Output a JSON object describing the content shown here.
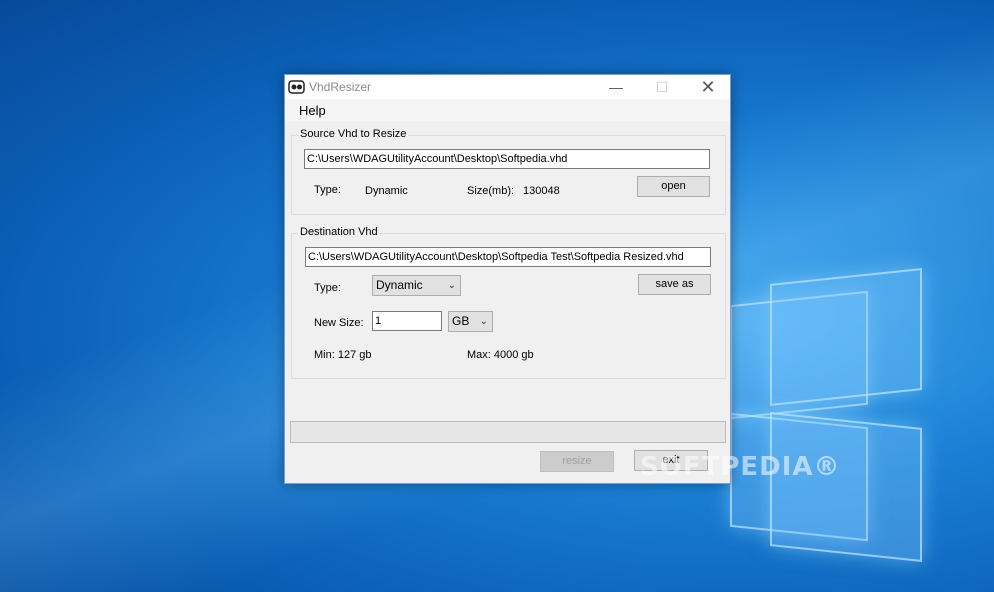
{
  "window": {
    "title": "VhdResizer",
    "minimize_glyph": "—",
    "maximize_glyph": "☐",
    "close_glyph": "✕"
  },
  "menu": {
    "help": "Help"
  },
  "source": {
    "group_label": "Source Vhd to Resize",
    "path": "C:\\Users\\WDAGUtilityAccount\\Desktop\\Softpedia.vhd",
    "type_label": "Type:",
    "type_value": "Dynamic",
    "size_label": "Size(mb):",
    "size_value": "130048",
    "open_label": "open"
  },
  "destination": {
    "group_label": "Destination Vhd",
    "path": "C:\\Users\\WDAGUtilityAccount\\Desktop\\Softpedia Test\\Softpedia Resized.vhd",
    "type_label": "Type:",
    "type_selected": "Dynamic",
    "save_as_label": "save as",
    "new_size_label": "New Size:",
    "new_size_value": "1",
    "unit_selected": "GB",
    "min_text": "Min: 127 gb",
    "max_text": "Max: 4000 gb"
  },
  "progress": {
    "fraction": 0
  },
  "actions": {
    "resize_label": "resize",
    "exit_label": "exit"
  },
  "watermark": "SOFTPEDIA®",
  "icons": {
    "app": "disk-drive-icon",
    "chevron": "chevron-down-icon"
  }
}
